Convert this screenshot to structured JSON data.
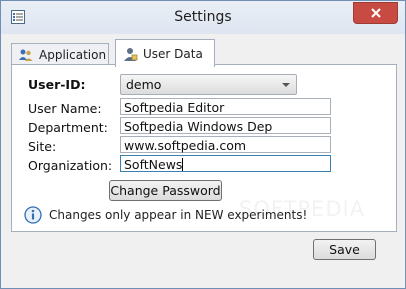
{
  "window": {
    "title": "Settings"
  },
  "tabs": [
    {
      "label": "Application",
      "icon": "people-icon",
      "active": false
    },
    {
      "label": "User Data",
      "icon": "user-icon",
      "active": true
    }
  ],
  "form": {
    "user_id": {
      "label": "User-ID:",
      "value": "demo"
    },
    "user_name": {
      "label": "User Name:",
      "value": "Softpedia Editor"
    },
    "department": {
      "label": "Department:",
      "value": "Softpedia Windows Dep"
    },
    "site": {
      "label": "Site:",
      "value": "www.softpedia.com"
    },
    "organization": {
      "label": "Organization:",
      "value": "SoftNews"
    },
    "change_password_label": "Change Password"
  },
  "info": {
    "text": "Changes only appear in NEW experiments!",
    "icon": "info-icon"
  },
  "footer": {
    "save_label": "Save"
  },
  "watermark": "SOFTPEDIA",
  "colors": {
    "close_button": "#c74b42",
    "focus_border": "#3c7fb1",
    "info_blue": "#2f6fb2"
  }
}
